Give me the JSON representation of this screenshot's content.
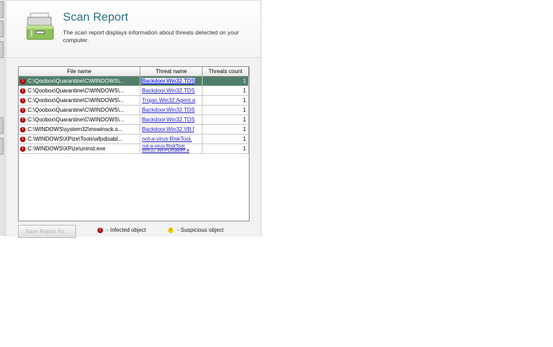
{
  "header": {
    "title": "Scan Report",
    "description": "The scan report displays information about threats detected on your computer."
  },
  "table": {
    "columns": [
      "File name",
      "Threat name",
      "Threats count"
    ],
    "rows": [
      {
        "file": "C:\\Qoobox\\Quarantine\\C\\WINDOWS\\...",
        "threat": "Backdoor.Win32.TDS",
        "count": "1"
      },
      {
        "file": "C:\\Qoobox\\Quarantine\\C\\WINDOWS\\...",
        "threat": "Backdoor.Win32.TDS",
        "count": "1"
      },
      {
        "file": "C:\\Qoobox\\Quarantine\\C\\WINDOWS\\...",
        "threat": "Trojan.Win32.Agent.a",
        "count": "1"
      },
      {
        "file": "C:\\Qoobox\\Quarantine\\C\\WINDOWS\\...",
        "threat": "Backdoor.Win32.TDS",
        "count": "1"
      },
      {
        "file": "C:\\Qoobox\\Quarantine\\C\\WINDOWS\\...",
        "threat": "Backdoor.Win32.TDS",
        "count": "1"
      },
      {
        "file": "C:\\WINDOWS\\system32\\mswinsck.o...",
        "threat": "Backdoor.Win32.VB.f",
        "count": "1"
      },
      {
        "file": "C:\\WINDOWS\\XPize\\Tools\\wfpdisabl...",
        "threat": "not-a-virus:RiskTool.",
        "count": "1"
      },
      {
        "file": "C:\\WINDOWS\\XPize\\uninst.exe",
        "threat": "not-a-virus:RiskTool. Win32.WFPDisabler.a",
        "count": "1"
      }
    ]
  },
  "footer": {
    "save_button": "Save Report As...",
    "legend_infected": "- Infected object",
    "legend_suspicious": "- Suspicious object"
  },
  "icons": {
    "row_icon": "infected-icon",
    "legend_infected_icon": "infected-icon",
    "legend_suspicious_icon": "suspicious-icon"
  },
  "colors": {
    "title": "#2e6e84",
    "selected_row": "#4f7f6a",
    "infected": "#b00808",
    "suspicious": "#f0d000",
    "link": "#1f1fbf"
  }
}
